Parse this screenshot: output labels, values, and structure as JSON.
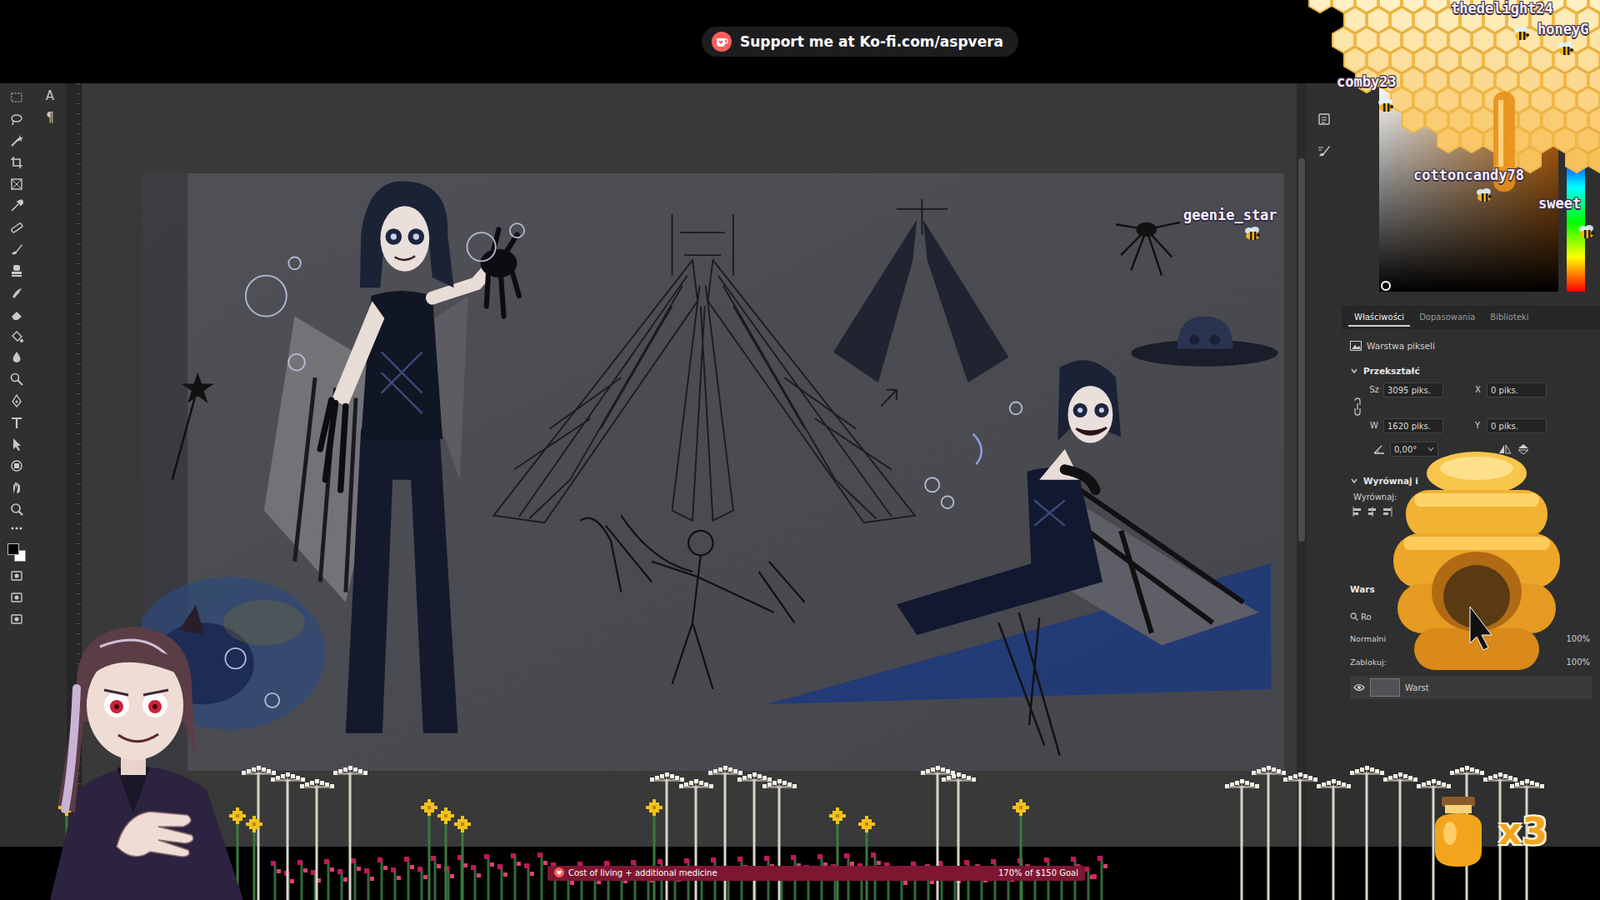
{
  "stream": {
    "kofi": "Support me at Ko-fi.com/aspvera"
  },
  "toolbar": {
    "glyphs": [
      "A",
      "¶"
    ]
  },
  "properties": {
    "tabs": [
      {
        "label": "Właściwości",
        "selected": true
      },
      {
        "label": "Dopasowania",
        "selected": false
      },
      {
        "label": "Biblioteki",
        "selected": false
      }
    ],
    "layer_kind": "Warstwa pikseli",
    "transform": {
      "title": "Przekształć",
      "expanded": true,
      "fields": [
        {
          "label": "Sz",
          "value": "3095 piks."
        },
        {
          "label": "X",
          "value": "0 piks."
        },
        {
          "label": "W",
          "value": "1620 piks."
        },
        {
          "label": "Y",
          "value": "0 piks."
        }
      ],
      "angle": "0,00°"
    },
    "align": {
      "title": "Wyrównaj i",
      "expanded": true,
      "label": "Wyrównaj:"
    }
  },
  "layers": {
    "title": "Wars",
    "search": "Ro",
    "blend": "Normalni",
    "opacity": "100%",
    "lock": "Zablokuj:",
    "fill": "100%",
    "layer": {
      "name": "Warst",
      "visible": true
    }
  },
  "chat": [
    {
      "name": "thedelight24"
    },
    {
      "name": "honeyG"
    },
    {
      "name": "comby23"
    },
    {
      "name": "cottoncandy78"
    },
    {
      "name": "sweet"
    },
    {
      "name": "geenie_star"
    }
  ],
  "honey": {
    "count": "x3"
  },
  "goal": {
    "title": "Cost of living + additional medicine",
    "reading": "170% of $150 Goal",
    "level": 1
  }
}
